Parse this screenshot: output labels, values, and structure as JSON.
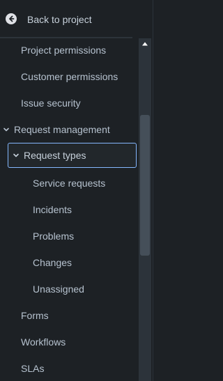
{
  "back": {
    "label": "Back to project",
    "icon": "arrow-left-circle-icon"
  },
  "nav": {
    "project_permissions": "Project permissions",
    "customer_permissions": "Customer permissions",
    "issue_security": "Issue security",
    "request_management": "Request management",
    "request_types": "Request types",
    "service_requests": "Service requests",
    "incidents": "Incidents",
    "problems": "Problems",
    "changes": "Changes",
    "unassigned": "Unassigned",
    "forms": "Forms",
    "workflows": "Workflows",
    "slas": "SLAs"
  },
  "colors": {
    "background": "#1d2125",
    "selected_border": "#85b8ff",
    "text": "#b6c2cf"
  }
}
